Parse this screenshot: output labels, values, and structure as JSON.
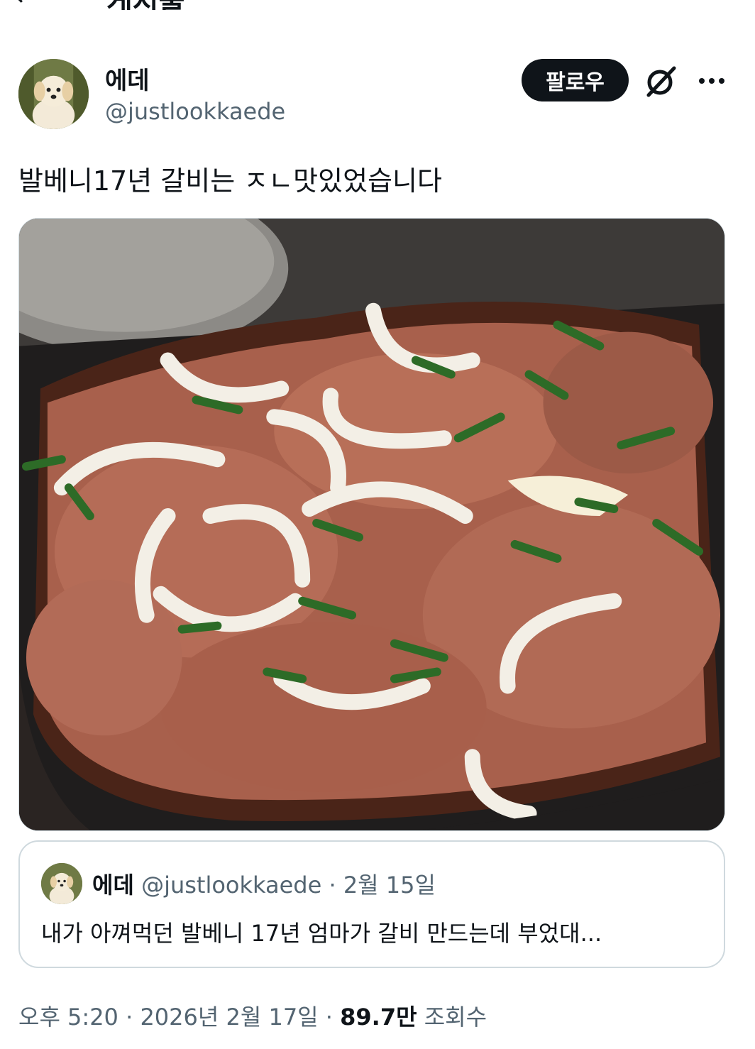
{
  "header": {
    "back_glyph": "←",
    "title_partial": "게시물"
  },
  "author": {
    "name": "에데",
    "handle": "@justlookkaede",
    "avatar_icon": "puppy-avatar"
  },
  "actions": {
    "follow_label": "팔로우",
    "grok_icon": "grok-icon",
    "more_icon": "more-icon"
  },
  "tweet": {
    "text": "발베니17년 갈비는 ㅈㄴ맛있었습니다"
  },
  "media": {
    "description_icon": "photo-galbi-on-grill"
  },
  "quote": {
    "name": "에데",
    "handle": "@justlookkaede",
    "separator": "·",
    "date": "2월 15일",
    "text": "내가 아껴먹던 발베니 17년 엄마가 갈비 만드는데 부었대..."
  },
  "footer": {
    "time": "오후 5:20",
    "separator": "·",
    "date": "2026년 2월 17일",
    "separator2": "·",
    "views_count": "89.7만",
    "views_label": "조회수"
  },
  "colors": {
    "text": "#0f1419",
    "secondary": "#536471",
    "border": "#cfd9de",
    "button_bg": "#0f1419"
  }
}
